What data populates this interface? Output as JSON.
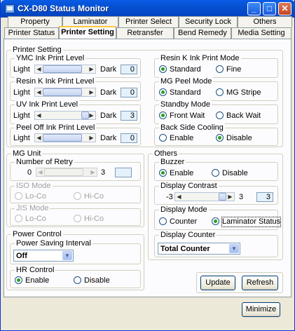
{
  "window": {
    "title": "CX-D80 Status Monitor",
    "min_glyph": "_",
    "max_glyph": "□",
    "close_glyph": "✕"
  },
  "tabs_row1": [
    "Property",
    "Laminator",
    "Printer Select",
    "Security Lock",
    "Others"
  ],
  "tabs_row2": [
    "Printer Status",
    "Printer Setting",
    "Retransfer",
    "Bend Remedy",
    "Media Setting"
  ],
  "active_tab": "Printer Setting",
  "printer_setting": {
    "label": "Printer Setting",
    "ymc": {
      "label": "YMC Ink Print Level",
      "left": "Light",
      "right": "Dark",
      "value": "0"
    },
    "resin_k": {
      "label": "Resin K Ink Print Level",
      "left": "Light",
      "right": "Dark",
      "value": "0"
    },
    "uv": {
      "label": "UV Ink Print Level",
      "left": "Light",
      "right": "Dark",
      "value": "3"
    },
    "peel_off": {
      "label": "Peel Off Ink Print Level",
      "left": "Light",
      "right": "Dark",
      "value": "0"
    },
    "resin_mode": {
      "label": "Resin K Ink Print Mode",
      "opt1": "Standard",
      "opt2": "Fine"
    },
    "mg_peel": {
      "label": "MG Peel Mode",
      "opt1": "Standard",
      "opt2": "MG Stripe"
    },
    "standby": {
      "label": "Standby Mode",
      "opt1": "Front Wait",
      "opt2": "Back Wait"
    },
    "backside": {
      "label": "Back Side Cooling",
      "opt1": "Enable",
      "opt2": "Disable"
    }
  },
  "mg_unit": {
    "label": "MG Unit",
    "retry": {
      "label": "Number of Retry",
      "min": "0",
      "max": "3",
      "value": ""
    },
    "iso": {
      "label": "ISO Mode",
      "opt1": "Lo-Co",
      "opt2": "Hi-Co"
    },
    "jis": {
      "label": "JIS Mode",
      "opt1": "Lo-Co",
      "opt2": "Hi-Co"
    }
  },
  "power": {
    "label": "Power Control",
    "saving": {
      "label": "Power Saving Interval",
      "value": "Off"
    },
    "hr": {
      "label": "HR Control",
      "opt1": "Enable",
      "opt2": "Disable"
    }
  },
  "others": {
    "label": "Others",
    "buzzer": {
      "label": "Buzzer",
      "opt1": "Enable",
      "opt2": "Disable"
    },
    "contrast": {
      "label": "Display Contrast",
      "min": "-3",
      "max": "3",
      "value": "3"
    },
    "mode": {
      "label": "Display Mode",
      "opt1": "Counter",
      "opt2": "Laminator Status"
    },
    "counter": {
      "label": "Display Counter",
      "value": "Total Counter"
    }
  },
  "buttons": {
    "update": "Update",
    "refresh": "Refresh",
    "minimize": "Minimize"
  }
}
